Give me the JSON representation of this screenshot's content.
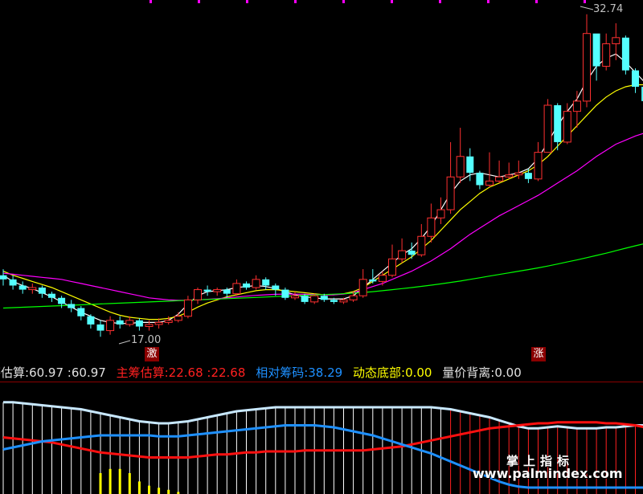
{
  "indicator_bar": {
    "item1": {
      "label": "筹估算",
      "value1": "60.97",
      "value2": "60.97",
      "color": "#e0e0e0"
    },
    "item2": {
      "label": "主筹估算",
      "value1": "22.68",
      "value2": "22.68",
      "color": "#ff2020"
    },
    "item3": {
      "label": "相对筹码",
      "value": "38.29",
      "color": "#1e90ff"
    },
    "item4": {
      "label": "动态底部",
      "value": "0.00",
      "color": "#ffff00"
    },
    "item5": {
      "label": "量价背离",
      "value": "0.00",
      "color": "#e0e0e0"
    }
  },
  "price_labels": {
    "high": "32.74",
    "low": "17.00"
  },
  "signals": {
    "buy": "激",
    "up": "涨"
  },
  "watermark": {
    "line1": "掌上指标",
    "line2": "www.palmindex.com"
  },
  "colors": {
    "up": "#ff3030",
    "down": "#54ffff",
    "ma5": "#ffffff",
    "ma10": "#ffff00",
    "ma20": "#ff00ff",
    "ma60": "#00ff00"
  },
  "chart_data": {
    "type": "candlestick",
    "candles": [
      [
        20.0,
        19.8,
        20.3,
        19.5
      ],
      [
        19.8,
        19.5,
        20.0,
        19.3
      ],
      [
        19.5,
        19.3,
        19.7,
        19.1
      ],
      [
        19.3,
        19.4,
        19.6,
        19.1
      ],
      [
        19.4,
        19.1,
        19.5,
        18.9
      ],
      [
        19.1,
        18.9,
        19.2,
        18.7
      ],
      [
        18.9,
        18.6,
        19.0,
        18.4
      ],
      [
        18.6,
        18.4,
        18.8,
        18.2
      ],
      [
        18.4,
        18.0,
        18.5,
        17.8
      ],
      [
        18.0,
        17.6,
        18.1,
        17.4
      ],
      [
        17.6,
        17.3,
        17.8,
        17.0
      ],
      [
        17.3,
        17.8,
        18.0,
        17.1
      ],
      [
        17.8,
        17.6,
        18.0,
        17.4
      ],
      [
        17.6,
        17.8,
        18.0,
        17.5
      ],
      [
        17.8,
        17.5,
        17.9,
        17.3
      ],
      [
        17.5,
        17.6,
        17.8,
        17.3
      ],
      [
        17.6,
        17.7,
        17.9,
        17.4
      ],
      [
        17.7,
        17.8,
        18.0,
        17.6
      ],
      [
        17.8,
        18.0,
        18.2,
        17.7
      ],
      [
        18.0,
        18.8,
        19.0,
        17.9
      ],
      [
        18.8,
        19.3,
        19.4,
        18.6
      ],
      [
        19.3,
        19.2,
        19.5,
        19.0
      ],
      [
        19.2,
        19.3,
        19.4,
        19.0
      ],
      [
        19.3,
        19.1,
        19.4,
        18.9
      ],
      [
        19.1,
        19.6,
        19.8,
        19.0
      ],
      [
        19.6,
        19.4,
        19.7,
        19.3
      ],
      [
        19.4,
        19.8,
        20.0,
        19.3
      ],
      [
        19.8,
        19.5,
        19.9,
        19.3
      ],
      [
        19.5,
        19.3,
        19.6,
        19.0
      ],
      [
        19.3,
        18.9,
        19.4,
        18.8
      ],
      [
        18.9,
        19.0,
        19.2,
        18.8
      ],
      [
        19.0,
        18.7,
        19.1,
        18.6
      ],
      [
        18.7,
        19.0,
        19.1,
        18.6
      ],
      [
        19.0,
        18.8,
        19.1,
        18.7
      ],
      [
        18.8,
        18.7,
        18.9,
        18.6
      ],
      [
        18.7,
        18.8,
        18.9,
        18.6
      ],
      [
        18.8,
        19.0,
        19.2,
        18.7
      ],
      [
        19.0,
        19.8,
        20.3,
        18.9
      ],
      [
        19.8,
        19.7,
        20.3,
        19.6
      ],
      [
        19.7,
        20.0,
        20.2,
        19.5
      ],
      [
        20.0,
        20.8,
        21.5,
        19.9
      ],
      [
        20.8,
        21.2,
        21.8,
        20.6
      ],
      [
        21.2,
        21.0,
        21.6,
        20.8
      ],
      [
        21.0,
        21.9,
        22.5,
        20.9
      ],
      [
        21.9,
        22.8,
        23.5,
        21.6
      ],
      [
        22.8,
        23.2,
        23.8,
        22.5
      ],
      [
        23.2,
        24.8,
        26.5,
        23.0
      ],
      [
        24.8,
        25.8,
        27.2,
        24.5
      ],
      [
        25.8,
        25.0,
        26.2,
        24.6
      ],
      [
        25.0,
        24.4,
        25.1,
        24.2
      ],
      [
        24.4,
        24.6,
        26.0,
        24.3
      ],
      [
        24.6,
        24.8,
        25.6,
        24.5
      ],
      [
        24.8,
        24.9,
        25.5,
        24.7
      ],
      [
        24.9,
        25.0,
        25.6,
        24.7
      ],
      [
        25.0,
        24.7,
        25.2,
        24.5
      ],
      [
        24.7,
        26.0,
        26.5,
        24.6
      ],
      [
        26.0,
        28.3,
        28.6,
        26.0
      ],
      [
        28.3,
        26.5,
        28.4,
        26.1
      ],
      [
        26.5,
        28.0,
        28.4,
        26.4
      ],
      [
        28.0,
        28.5,
        29.0,
        27.2
      ],
      [
        28.5,
        31.8,
        32.74,
        28.2
      ],
      [
        31.8,
        30.2,
        31.5,
        29.5
      ],
      [
        30.2,
        31.3,
        31.8,
        30.0
      ],
      [
        31.3,
        31.6,
        32.3,
        30.5
      ],
      [
        31.6,
        30.0,
        31.7,
        29.8
      ],
      [
        30.0,
        29.2,
        30.1,
        28.9
      ],
      [
        29.2,
        28.5,
        29.4,
        28.2
      ]
    ],
    "ma": [
      {
        "name": "MA5",
        "values": [
          20.0,
          19.7,
          19.5,
          19.35,
          19.15,
          18.95,
          18.7,
          18.45,
          18.2,
          18.0,
          17.8,
          17.7,
          17.65,
          17.65,
          17.7,
          17.7,
          17.7,
          17.8,
          18.1,
          18.6,
          19.0,
          19.2,
          19.25,
          19.3,
          19.4,
          19.45,
          19.5,
          19.45,
          19.35,
          19.2,
          19.05,
          18.95,
          18.9,
          18.85,
          18.85,
          18.85,
          19.0,
          19.4,
          19.8,
          20.2,
          20.6,
          21.0,
          21.3,
          21.8,
          22.4,
          23.2,
          24.0,
          24.6,
          24.9,
          25.0,
          24.9,
          24.8,
          24.9,
          25.0,
          25.2,
          25.7,
          26.5,
          27.3,
          28.0,
          28.6,
          29.5,
          30.2,
          30.6,
          30.8,
          30.4,
          29.9,
          29.4
        ]
      },
      {
        "name": "MA10",
        "values": [
          20.2,
          20.0,
          19.85,
          19.7,
          19.55,
          19.4,
          19.2,
          19.0,
          18.8,
          18.6,
          18.4,
          18.2,
          18.05,
          17.95,
          17.9,
          17.85,
          17.85,
          17.9,
          18.0,
          18.2,
          18.45,
          18.65,
          18.8,
          18.95,
          19.05,
          19.15,
          19.25,
          19.3,
          19.3,
          19.25,
          19.2,
          19.15,
          19.1,
          19.05,
          19.05,
          19.1,
          19.2,
          19.4,
          19.7,
          20.0,
          20.3,
          20.6,
          20.9,
          21.3,
          21.7,
          22.2,
          22.7,
          23.2,
          23.6,
          24.0,
          24.3,
          24.5,
          24.7,
          24.9,
          25.1,
          25.4,
          25.8,
          26.3,
          26.8,
          27.3,
          27.8,
          28.3,
          28.7,
          29.0,
          29.2,
          29.3,
          29.3
        ]
      },
      {
        "name": "MA20",
        "values": [
          20.1,
          20.05,
          20.0,
          19.95,
          19.9,
          19.85,
          19.8,
          19.7,
          19.6,
          19.5,
          19.4,
          19.3,
          19.2,
          19.1,
          19.0,
          18.9,
          18.85,
          18.8,
          18.78,
          18.78,
          18.8,
          18.83,
          18.86,
          18.9,
          18.94,
          18.98,
          19.02,
          19.05,
          19.07,
          19.08,
          19.08,
          19.07,
          19.06,
          19.05,
          19.05,
          19.08,
          19.15,
          19.3,
          19.45,
          19.6,
          19.8,
          20.0,
          20.2,
          20.45,
          20.7,
          21.0,
          21.3,
          21.65,
          22.0,
          22.3,
          22.6,
          22.9,
          23.15,
          23.4,
          23.65,
          23.9,
          24.2,
          24.5,
          24.8,
          25.1,
          25.45,
          25.8,
          26.1,
          26.4,
          26.6,
          26.8,
          26.95
        ]
      },
      {
        "name": "MA60",
        "values": [
          18.4,
          18.42,
          18.44,
          18.46,
          18.48,
          18.5,
          18.52,
          18.54,
          18.56,
          18.58,
          18.6,
          18.62,
          18.64,
          18.66,
          18.68,
          18.7,
          18.72,
          18.74,
          18.76,
          18.78,
          18.8,
          18.82,
          18.84,
          18.86,
          18.88,
          18.9,
          18.92,
          18.94,
          18.96,
          18.98,
          19.0,
          19.02,
          19.04,
          19.06,
          19.08,
          19.1,
          19.13,
          19.16,
          19.2,
          19.25,
          19.3,
          19.35,
          19.4,
          19.46,
          19.52,
          19.58,
          19.65,
          19.72,
          19.8,
          19.88,
          19.96,
          20.04,
          20.12,
          20.2,
          20.28,
          20.36,
          20.45,
          20.55,
          20.65,
          20.75,
          20.86,
          20.97,
          21.08,
          21.2,
          21.32,
          21.44,
          21.55
        ]
      }
    ],
    "sub_indicator": {
      "white_line": [
        85,
        85,
        84,
        83,
        82,
        81,
        80,
        79,
        78,
        76,
        74,
        72,
        70,
        68,
        66,
        65,
        64,
        64,
        65,
        66,
        68,
        70,
        72,
        74,
        76,
        77,
        78,
        79,
        80,
        80,
        80,
        80,
        80,
        80,
        80,
        80,
        80,
        80,
        80,
        80,
        80,
        80,
        80,
        80,
        80,
        79,
        78,
        76,
        74,
        72,
        70,
        67,
        64,
        61,
        59,
        59,
        60,
        61,
        60,
        59,
        59,
        59,
        60,
        60,
        61,
        62,
        62
      ],
      "blue_line": [
        38,
        40,
        42,
        44,
        46,
        47,
        48,
        49,
        50,
        51,
        52,
        52,
        52,
        52,
        52,
        52,
        51,
        51,
        51,
        52,
        53,
        54,
        55,
        56,
        57,
        58,
        59,
        60,
        61,
        62,
        62,
        62,
        62,
        61,
        60,
        58,
        56,
        54,
        52,
        49,
        46,
        43,
        40,
        37,
        34,
        30,
        26,
        22,
        18,
        14,
        10,
        6,
        3,
        1,
        0,
        0,
        0,
        0,
        0,
        0,
        0,
        0,
        0,
        0,
        0,
        0,
        0
      ],
      "red_line": [
        50,
        49,
        48,
        47,
        46,
        45,
        43,
        41,
        39,
        37,
        35,
        34,
        33,
        32,
        31,
        30,
        30,
        30,
        30,
        30,
        31,
        32,
        33,
        33,
        34,
        35,
        35,
        36,
        36,
        36,
        36,
        37,
        37,
        37,
        37,
        37,
        37,
        37,
        38,
        39,
        40,
        41,
        43,
        45,
        47,
        49,
        51,
        53,
        55,
        57,
        59,
        60,
        61,
        62,
        63,
        64,
        64,
        65,
        65,
        65,
        65,
        65,
        64,
        64,
        63,
        62,
        60
      ],
      "yellow_bars": [
        0,
        0,
        0,
        0,
        0,
        0,
        0,
        0,
        0,
        0,
        10,
        12,
        12,
        10,
        6,
        4,
        3,
        2,
        1,
        0,
        0,
        0,
        0,
        0,
        0,
        0,
        0,
        0,
        0,
        0,
        0,
        0,
        0,
        0,
        0,
        0,
        0,
        0,
        0,
        0,
        0,
        0,
        0,
        0,
        0,
        0,
        0,
        0,
        0,
        0,
        0,
        0,
        0,
        0,
        0,
        0,
        0,
        0,
        0,
        0,
        0,
        0,
        0,
        0,
        0,
        0,
        0
      ]
    }
  }
}
